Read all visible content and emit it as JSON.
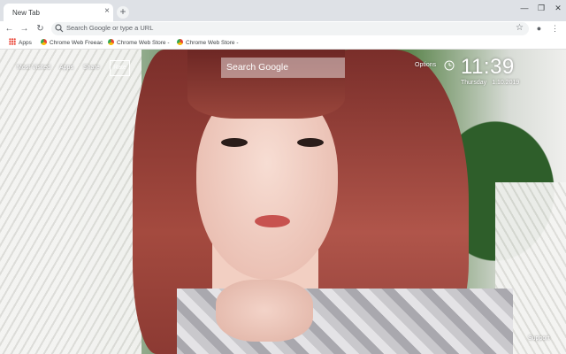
{
  "browser": {
    "tab_title": "New Tab",
    "tab_close_icon": "×",
    "new_tab_icon": "+",
    "omnibox_placeholder": "Search Google or type a URL",
    "bookmarks": [
      {
        "label": "Apps",
        "icon": "apps-grid-icon"
      },
      {
        "label": "Chrome Web Freeac",
        "icon": "chrome-web-store-icon"
      },
      {
        "label": "Chrome Web Store -",
        "icon": "chrome-web-store-icon"
      },
      {
        "label": "Chrome Web Store -",
        "icon": "chrome-web-store-icon"
      }
    ]
  },
  "newtab": {
    "nav_links": [
      "Most Visited",
      "Apps",
      "Share"
    ],
    "rate_label": "Rate",
    "search_placeholder": "Search Google",
    "options_label": "Options",
    "time": "11:39",
    "day": "Thursday",
    "date": "1.10.2019",
    "support_label": "Support"
  },
  "colors": {
    "chrome_bg": "#dee1e6",
    "text_overlay": "#ffffff",
    "accent_green": "#4d7a3d",
    "hair_red": "#a44a3f"
  }
}
